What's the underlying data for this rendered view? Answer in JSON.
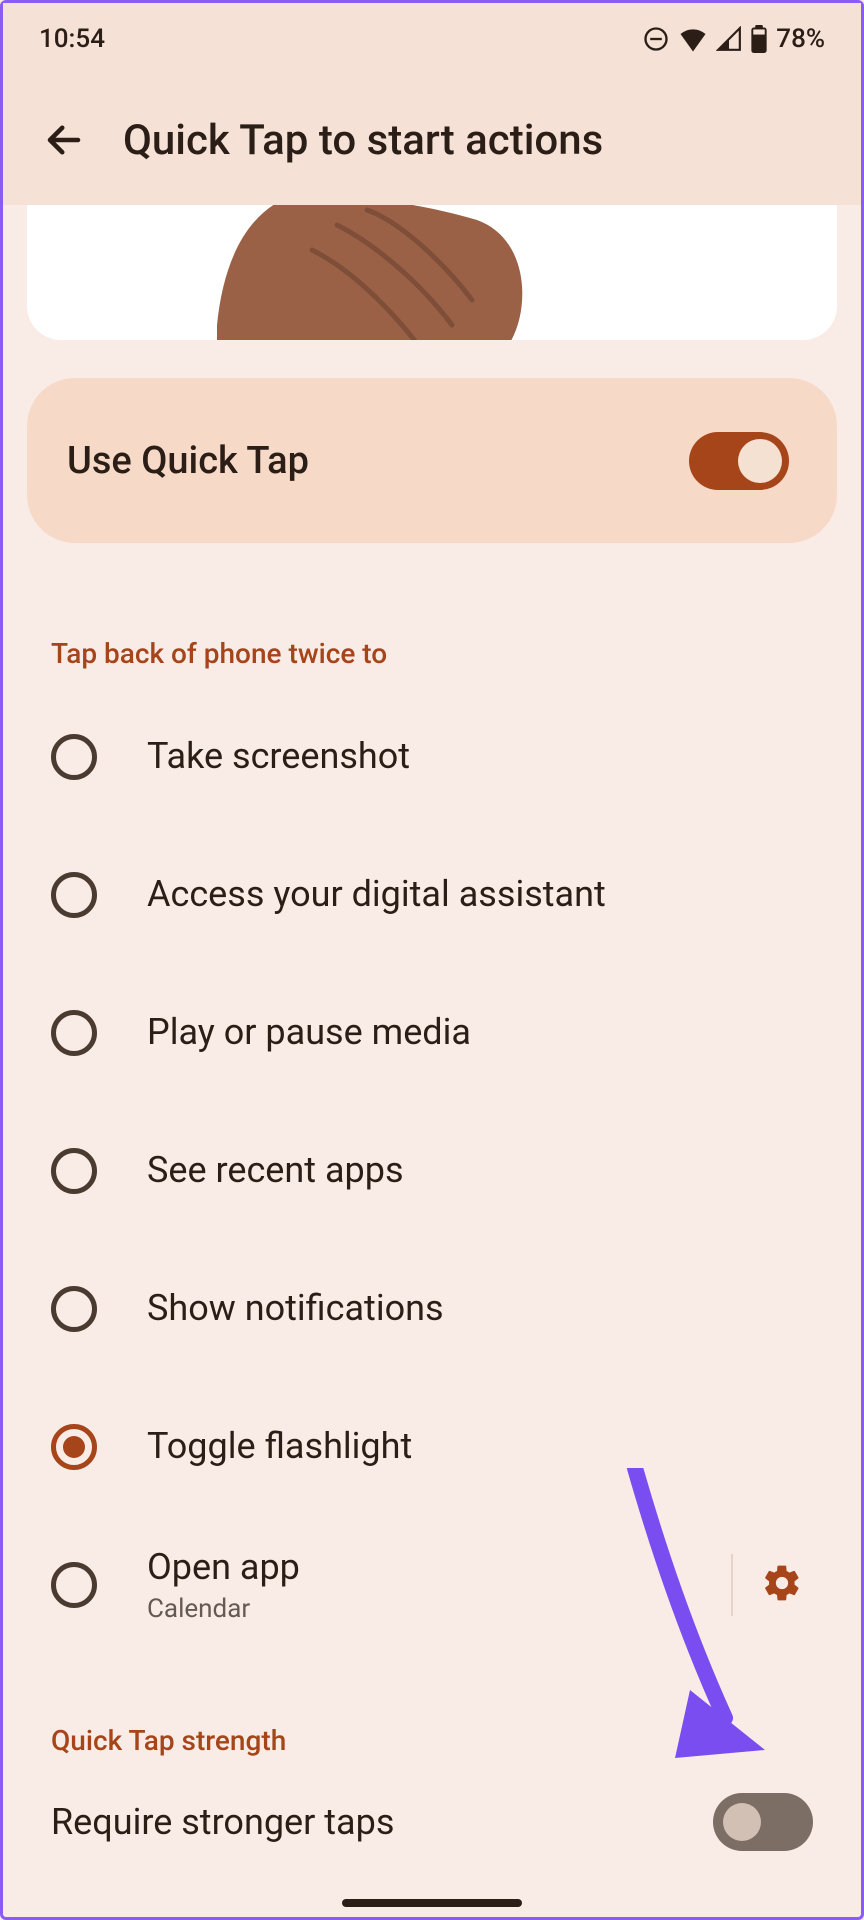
{
  "status": {
    "time": "10:54",
    "battery": "78%"
  },
  "header": {
    "title": "Quick Tap to start actions"
  },
  "quickTapToggle": {
    "label": "Use Quick Tap",
    "enabled": true
  },
  "actionSection": {
    "heading": "Tap back of phone twice to",
    "options": [
      {
        "label": "Take screenshot",
        "selected": false
      },
      {
        "label": "Access your digital assistant",
        "selected": false
      },
      {
        "label": "Play or pause media",
        "selected": false
      },
      {
        "label": "See recent apps",
        "selected": false
      },
      {
        "label": "Show notifications",
        "selected": false
      },
      {
        "label": "Toggle flashlight",
        "selected": true
      },
      {
        "label": "Open app",
        "sublabel": "Calendar",
        "selected": false,
        "hasGear": true
      }
    ]
  },
  "strengthSection": {
    "heading": "Quick Tap strength",
    "toggleLabel": "Require stronger taps",
    "toggleEnabled": false
  },
  "colors": {
    "accent": "#a6441a",
    "surface": "#f9ece6",
    "pill": "#f7d9c8",
    "appbar": "#f5e1d6",
    "annotation": "#7a4df0"
  }
}
